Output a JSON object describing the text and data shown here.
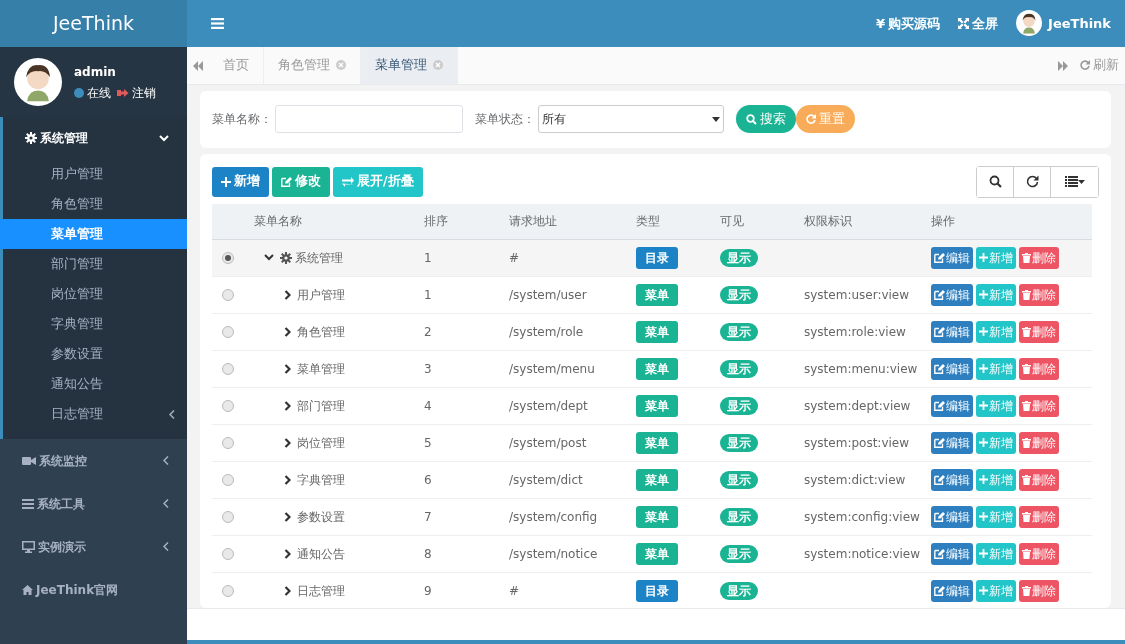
{
  "brand": "JeeThink",
  "user": {
    "name": "admin",
    "status": "在线",
    "logout": "注销"
  },
  "sidebar": {
    "items": [
      {
        "label": "系统管理",
        "expanded": true,
        "children": [
          {
            "label": "用户管理",
            "selected": false,
            "has_children": false
          },
          {
            "label": "角色管理",
            "selected": false,
            "has_children": false
          },
          {
            "label": "菜单管理",
            "selected": true,
            "has_children": false
          },
          {
            "label": "部门管理",
            "selected": false,
            "has_children": false
          },
          {
            "label": "岗位管理",
            "selected": false,
            "has_children": false
          },
          {
            "label": "字典管理",
            "selected": false,
            "has_children": false
          },
          {
            "label": "参数设置",
            "selected": false,
            "has_children": false
          },
          {
            "label": "通知公告",
            "selected": false,
            "has_children": false
          },
          {
            "label": "日志管理",
            "selected": false,
            "has_children": true
          }
        ]
      },
      {
        "label": "系统监控",
        "expanded": false
      },
      {
        "label": "系统工具",
        "expanded": false
      },
      {
        "label": "实例演示",
        "expanded": false
      },
      {
        "label": "JeeThink官网"
      }
    ]
  },
  "header": {
    "buy": {
      "icon_char": "¥",
      "label": "购买源码"
    },
    "fullscreen": "全屏",
    "account": "JeeThink"
  },
  "tabs": [
    {
      "label": "首页",
      "closable": false,
      "selected": false
    },
    {
      "label": "角色管理",
      "closable": true,
      "selected": false
    },
    {
      "label": "菜单管理",
      "closable": true,
      "selected": true
    }
  ],
  "refresh": "刷新",
  "search": {
    "name_label": "菜单名称：",
    "status_label": "菜单状态：",
    "status_value": "所有",
    "search_button": "搜索",
    "reset_button": "重置"
  },
  "toolbar": {
    "add": "新增",
    "edit": "修改",
    "toggle": "展开/折叠"
  },
  "table": {
    "columns": [
      "菜单名称",
      "排序",
      "请求地址",
      "类型",
      "可见",
      "权限标识",
      "操作"
    ],
    "rows": [
      {
        "selected": true,
        "name": "系统管理",
        "expanded": true,
        "order": "1",
        "url": "#",
        "type": {
          "kind": "dir",
          "label": "目录"
        },
        "visible": "显示",
        "actions": [
          "编辑",
          "新增",
          "删除"
        ],
        "children": [
          {
            "selected": false,
            "name": "用户管理",
            "expanded": false,
            "order": "1",
            "url": "/system/user",
            "type": {
              "kind": "menu",
              "label": "菜单"
            },
            "visible": "显示",
            "perm": "system:user:view",
            "actions": [
              "编辑",
              "新增",
              "删除"
            ]
          },
          {
            "selected": false,
            "name": "角色管理",
            "expanded": false,
            "order": "2",
            "url": "/system/role",
            "type": {
              "kind": "menu",
              "label": "菜单"
            },
            "visible": "显示",
            "perm": "system:role:view",
            "actions": [
              "编辑",
              "新增",
              "删除"
            ]
          },
          {
            "selected": false,
            "name": "菜单管理",
            "expanded": false,
            "order": "3",
            "url": "/system/menu",
            "type": {
              "kind": "menu",
              "label": "菜单"
            },
            "visible": "显示",
            "perm": "system:menu:view",
            "actions": [
              "编辑",
              "新增",
              "删除"
            ]
          },
          {
            "selected": false,
            "name": "部门管理",
            "expanded": false,
            "order": "4",
            "url": "/system/dept",
            "type": {
              "kind": "menu",
              "label": "菜单"
            },
            "visible": "显示",
            "perm": "system:dept:view",
            "actions": [
              "编辑",
              "新增",
              "删除"
            ]
          },
          {
            "selected": false,
            "name": "岗位管理",
            "expanded": false,
            "order": "5",
            "url": "/system/post",
            "type": {
              "kind": "menu",
              "label": "菜单"
            },
            "visible": "显示",
            "perm": "system:post:view",
            "actions": [
              "编辑",
              "新增",
              "删除"
            ]
          },
          {
            "selected": false,
            "name": "字典管理",
            "expanded": false,
            "order": "6",
            "url": "/system/dict",
            "type": {
              "kind": "menu",
              "label": "菜单"
            },
            "visible": "显示",
            "perm": "system:dict:view",
            "actions": [
              "编辑",
              "新增",
              "删除"
            ]
          },
          {
            "selected": false,
            "name": "参数设置",
            "expanded": false,
            "order": "7",
            "url": "/system/config",
            "type": {
              "kind": "menu",
              "label": "菜单"
            },
            "visible": "显示",
            "perm": "system:config:view",
            "actions": [
              "编辑",
              "新增",
              "删除"
            ]
          },
          {
            "selected": false,
            "name": "通知公告",
            "expanded": false,
            "order": "8",
            "url": "/system/notice",
            "type": {
              "kind": "menu",
              "label": "菜单"
            },
            "visible": "显示",
            "perm": "system:notice:view",
            "actions": [
              "编辑",
              "新增",
              "删除"
            ]
          },
          {
            "selected": false,
            "name": "日志管理",
            "expanded": false,
            "order": "9",
            "url": "#",
            "type": {
              "kind": "dir",
              "label": "目录"
            },
            "visible": "显示",
            "actions": [
              "编辑",
              "新增",
              "删除"
            ]
          }
        ]
      }
    ]
  }
}
